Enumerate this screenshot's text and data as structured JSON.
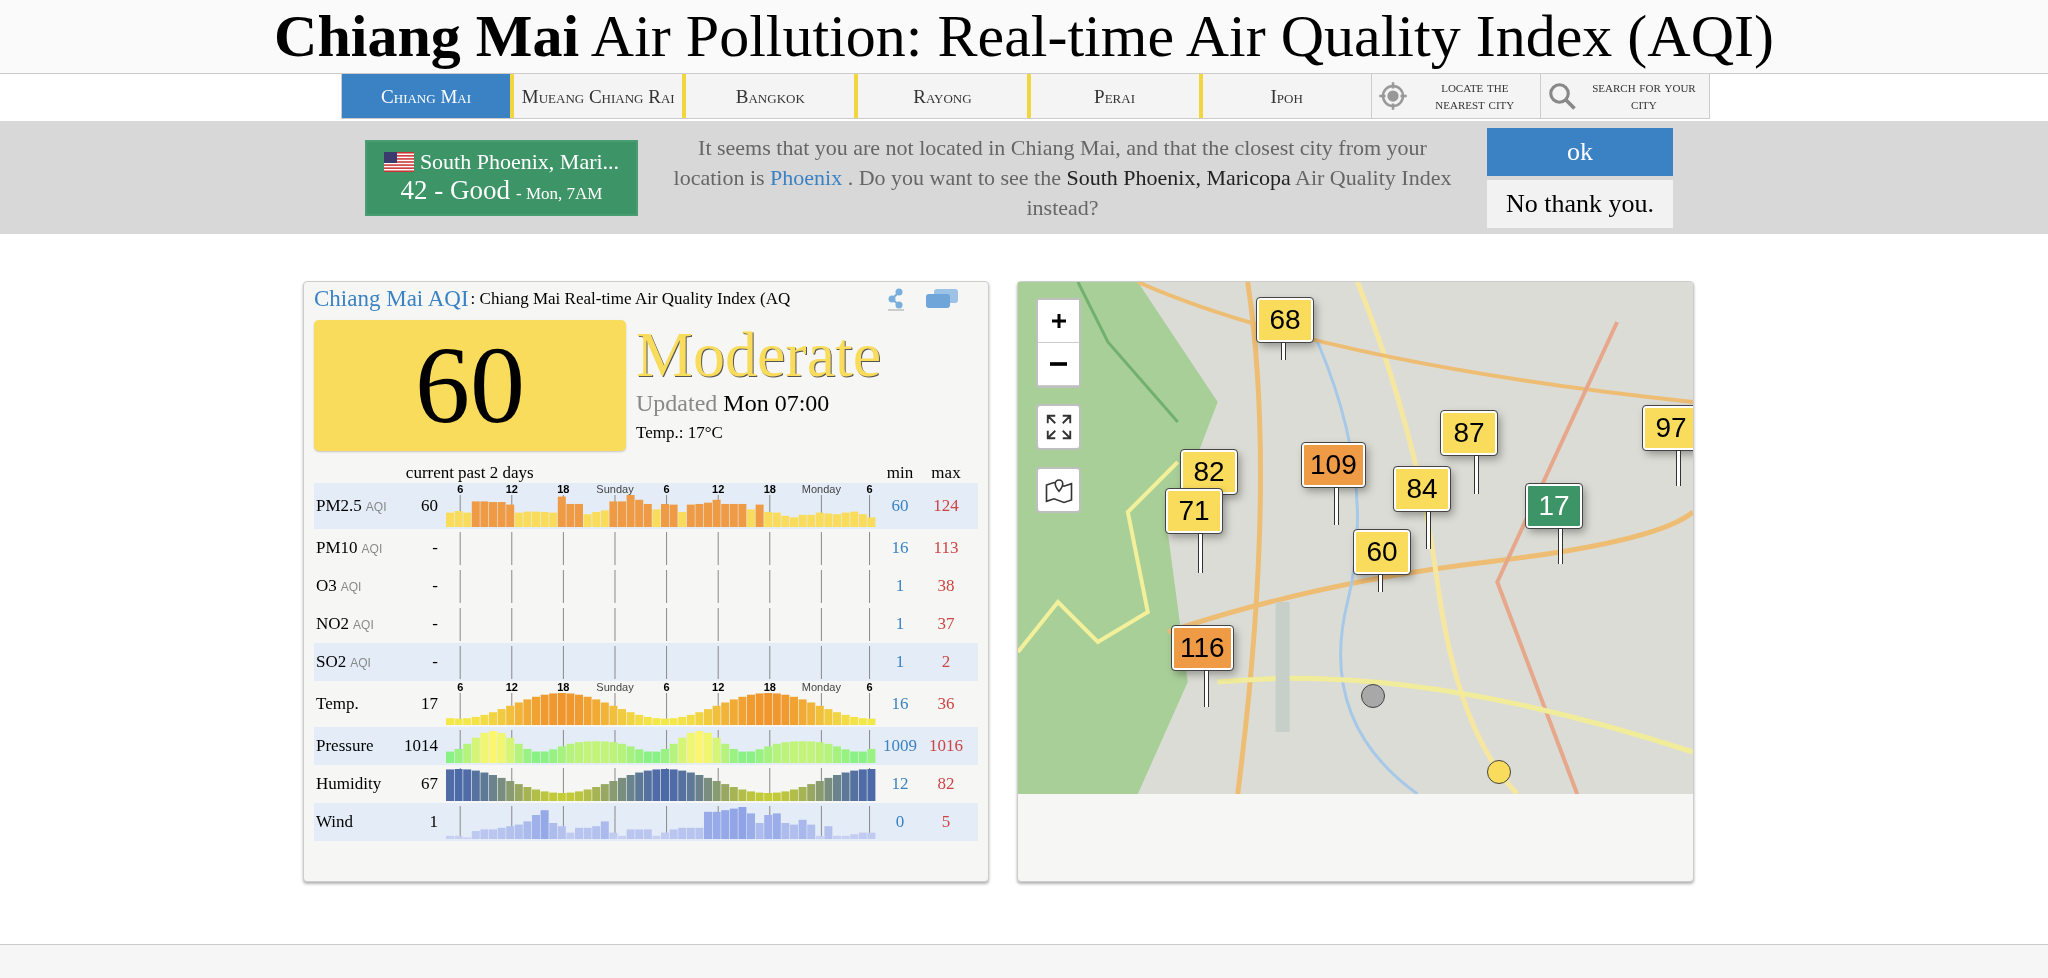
{
  "page_title": "**Chiang Mai** Air Pollution: Real-time Air Quality Index (AQI)",
  "nav": {
    "tabs": [
      {
        "label": "Chiang Mai",
        "selected": true
      },
      {
        "label": "Mueang Chiang Rai",
        "selected": false
      },
      {
        "label": "Bangkok",
        "selected": false
      },
      {
        "label": "Rayong",
        "selected": false
      },
      {
        "label": "Perai",
        "selected": false
      },
      {
        "label": "Ipoh",
        "selected": false
      }
    ],
    "actions": [
      {
        "kind": "locate",
        "label": "locate the nearest city"
      },
      {
        "kind": "search",
        "label": "search for your city"
      }
    ]
  },
  "location_banner": {
    "city": "South Phoenix, Mari...",
    "aqi": "42 - Good",
    "time": "- Mon, 7AM",
    "message": {
      "before": "It seems that you are not located in Chiang Mai, and that the closest city from your location is",
      "link": "Phoenix",
      "middle": ". Do you want to see the",
      "place": "South Phoenix, Maricopa",
      "after": "Air Quality Index instead?"
    },
    "buttons": [
      "ok",
      "No thank you."
    ]
  },
  "aqi_card": {
    "link": "Chiang Mai AQI",
    "subtitle": ": Chiang Mai Real-time Air Quality Index (AQ",
    "aqi": "60",
    "level": "Moderate",
    "updated_label": "Updated",
    "updated": "Mon 07:00",
    "temperature": "Temp.: 17°C",
    "columns": {
      "current": "current",
      "history": "past 2 days",
      "min": "min",
      "max": "max"
    },
    "rows": [
      {
        "name": "PM2.5",
        "unit": "AQI",
        "current": "60",
        "min": "60",
        "max": "124",
        "kind": "aqi",
        "time_labels": [
          "6",
          "12",
          "18",
          "Sunday",
          "6",
          "12",
          "18",
          "Monday",
          "6"
        ],
        "shaded": true
      },
      {
        "name": "PM10",
        "unit": "AQI",
        "current": "-",
        "min": "16",
        "max": "113",
        "kind": "none",
        "shaded": false
      },
      {
        "name": "O3",
        "unit": "AQI",
        "current": "-",
        "min": "1",
        "max": "38",
        "kind": "none",
        "shaded": false
      },
      {
        "name": "NO2",
        "unit": "AQI",
        "current": "-",
        "min": "1",
        "max": "37",
        "kind": "none",
        "shaded": false
      },
      {
        "name": "SO2",
        "unit": "AQI",
        "current": "-",
        "min": "1",
        "max": "2",
        "kind": "none",
        "shaded": true
      },
      {
        "name": "Temp.",
        "current": "17",
        "min": "16",
        "max": "36",
        "kind": "temperature",
        "time_labels": [
          "6",
          "12",
          "18",
          "Sunday",
          "6",
          "12",
          "18",
          "Monday",
          "6"
        ],
        "shaded": false
      },
      {
        "name": "Pressure",
        "current": "1014",
        "min": "1009",
        "max": "1016",
        "kind": "pressure",
        "shaded": true
      },
      {
        "name": "Humidity",
        "current": "67",
        "min": "12",
        "max": "82",
        "kind": "humidity",
        "shaded": false
      },
      {
        "name": "Wind",
        "current": "1",
        "min": "0",
        "max": "5",
        "kind": "wind",
        "shaded": true
      }
    ]
  },
  "map": {
    "kind": "picture",
    "markers": [
      {
        "kind": "label",
        "value": "68",
        "color": "#f9dc5c"
      },
      {
        "kind": "label",
        "value": "82",
        "color": "#f9dc5c"
      },
      {
        "kind": "label",
        "value": "71",
        "color": "#f9dc5c"
      },
      {
        "kind": "label",
        "value": "109",
        "color": "#ef9a45"
      },
      {
        "kind": "label",
        "value": "60",
        "color": "#f9dc5c"
      },
      {
        "kind": "label",
        "value": "87",
        "color": "#f9dc5c"
      },
      {
        "kind": "label",
        "value": "84",
        "color": "#f9dc5c"
      },
      {
        "kind": "label",
        "value": "17",
        "color": "#3d9466"
      },
      {
        "kind": "label",
        "value": "97",
        "color": "#f9dc5c"
      },
      {
        "kind": "label",
        "value": "116",
        "color": "#ef9a45"
      },
      {
        "kind": "dot",
        "color": "#a8a8a8"
      },
      {
        "kind": "dot",
        "color": "#f9dc5c"
      }
    ]
  }
}
